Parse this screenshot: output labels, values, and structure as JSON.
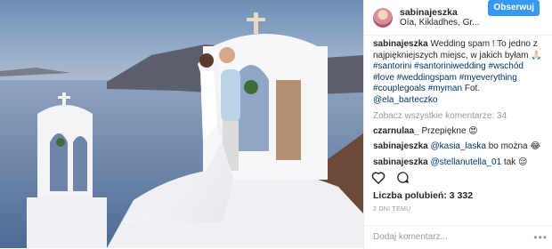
{
  "header": {
    "username": "sabinajeszka",
    "location": "Oía, Kikladhes, Gr...",
    "follow_label": "Obserwuj"
  },
  "caption": {
    "username": "sabinajeszka",
    "text": "Wedding spam ! To jedno z najpiękniejszych miejsc, w jakich byłam 🙏🏻",
    "hashtags": "#santorini #santoriniwedding #wschód #love #weddingspam #myeverything #couplegoals #myman",
    "fot_label": "Fot.",
    "mention": "@ela_barteczko"
  },
  "view_all": "Zobacz wszystkie komentarze: 34",
  "comments": [
    {
      "user": "czarnulaa_",
      "text": "Przepiękne 😍"
    },
    {
      "user": "sabinajeszka",
      "mention": "@kasia_laska",
      "text": "bo można 😂"
    },
    {
      "user": "sabinajeszka",
      "mention": "@stellanutella_01",
      "text": "tak 😌"
    }
  ],
  "likes_label": "Liczba polubień:",
  "likes_count": "3 332",
  "time_ago": "2 DNI TEMU",
  "add_comment_placeholder": "Dodaj komentarz...",
  "more_options": "•••",
  "icons": [
    "heart-icon",
    "comment-icon"
  ]
}
